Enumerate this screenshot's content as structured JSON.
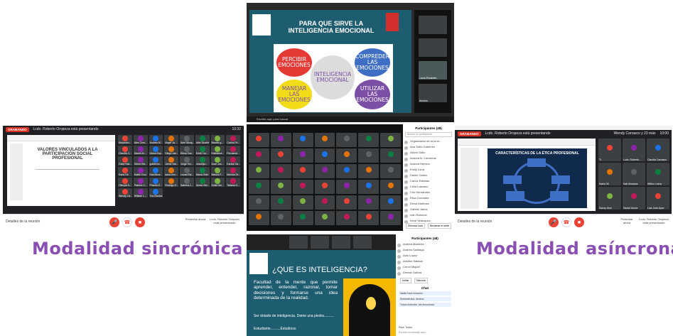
{
  "captions": {
    "sync": "Modalidad sincrónica",
    "async": "Modalidad asíncrona"
  },
  "left_meet": {
    "recording_label": "GRABANDO",
    "presenter": "Lcdo. Roberto Oropeza está presentando",
    "clock": "10:32",
    "slide_title": "VALORES VINCULADOS A LA PARTICIPACIÓN SOCIAL PROFESIONAL",
    "details_label": "Detalles de la reunión",
    "present_label": "Presentar ahora",
    "right_label": "Lcdo. Roberto Oropeza está presentando",
    "participants": [
      "Alejandro...",
      "Alex Cero...",
      "Andrea M...",
      "Angel Ja...",
      "Ariel Mong...",
      "Ariel Duarte",
      "Beatriz g...",
      "Carlos Fe...",
      "Claudia C...",
      "Daniel Ar...",
      "Diana Esp...",
      "Diego Jan...",
      "Elena Gar...",
      "Emili Car...",
      "Estefanía...",
      "Fernando...",
      "Gaby Hdz...",
      "Gilma Hid...",
      "guillermo...",
      "Jaime Sar...",
      "Jorge Ort...",
      "Josselyn...",
      "Juan Jos...",
      "Karina Ga...",
      "Karla Gil",
      "Kattie Cruz",
      "Kati Alma...",
      "laura cen...",
      "Lucas Ela...",
      "María Ortiz",
      "Marina F...",
      "Mónica Or...",
      "Olimpia S...",
      "Patricio C...",
      "Priscila E...",
      "Rodrigo G...",
      "Sabrina L...",
      "Sonia Vier...",
      "Sofia Her...",
      "Tatiana O...",
      "Wendy Ca...",
      "William L...",
      "Yuri Santos"
    ]
  },
  "center_top": {
    "title_line1": "PARA QUE SIRVE LA",
    "title_line2": "INTELIGENCIA EMOCIONAL",
    "bubbles": [
      "PERCIBIR EMOCIONES",
      "COMPREDER LAS EMOCIONES",
      "INTELIGENCIA EMOCIONAL",
      "MANEJAR LAS EMOCIONES",
      "UTILIZAR LAS EMOCIONES"
    ],
    "search_text": "Escribe aquí para buscar",
    "video_names": [
      "Laura Elizabeth...",
      "Alumno"
    ]
  },
  "center_mid": {
    "panel_title": "Participantes (48)",
    "search_placeholder": "Buscar un participante",
    "list": [
      "Organizador de la reun...",
      "Ana Sofía Gutiérrez",
      "Alison Gallo",
      "Andrea N. Contreras",
      "Andrea Herrera",
      "Emily Luna",
      "Daniel Castro",
      "Carlos Esteban",
      "Celia Lazcano",
      "Ciro Hernández",
      "Elisa González",
      "Elena Martínez",
      "Gabriel Jaime",
      "Iván Ramírez",
      "Irene Velázquez"
    ],
    "mute_all": "Silenciar todo",
    "raise_hand": "Reclamar el anfitr"
  },
  "center_bottom": {
    "title": "¿QUE ES INTELIGENCIA?",
    "paragraph": "Facultad de la mente que permite aprender, entender, razonar, tomar decisiones y formarse una idea determinada de la realidad.",
    "extra": "Ser dotado de inteligencia. Dame una piedra..........",
    "footer": "Estudiante..........Estudioso",
    "panel_title": "Participantes (48)",
    "chat_title": "Chat",
    "chat_to": "Para: Todos",
    "chat_placeholder": "Escribe tu mensaje aquí...",
    "list": [
      "Andrea Martínez",
      "Andrea Santiago",
      "Aldo Lopez",
      "Aristhel Salazar",
      "Ceron Miguel",
      "Dereck Galicia"
    ],
    "chat_msgs": [
      "Nadie hace emoción",
      "Sentimientos, deseos",
      "Todos entender, las emociones"
    ],
    "invite": "Invitar",
    "mute": "Silenciar"
  },
  "right_meet": {
    "recording_label": "GRABANDO",
    "presenter": "Lcdo. Roberto Oropeza está presentando",
    "host": "Wendy Carrasco y 23 más",
    "clock": "10:00",
    "slide_title": "CARACTERÍSTICAS DE LA ÉTICA PROFESIONAL",
    "details_label": "Detalles de la reunión",
    "present_label": "Presentar ahora",
    "right_label": "Lcdo. Roberto Oropeza está presentando",
    "participants": [
      "Ti",
      "Lcdo. Roberto...",
      "Claudia Carrasco",
      "Karla Gil",
      "Kati Almanza",
      "Wilbur Lebra",
      "Sandy Alva",
      "Daniel Aceve",
      "Luis José Ayon"
    ]
  },
  "colors": {
    "caption": "#8a4fb3",
    "meet_dark": "#202124",
    "record": "#d93025",
    "teal": "#1e5d70",
    "bubble_red": "#e53935",
    "bubble_blue": "#3f6fc4",
    "bubble_yellow": "#f2dc1a",
    "bubble_purple": "#7b4fa6"
  }
}
